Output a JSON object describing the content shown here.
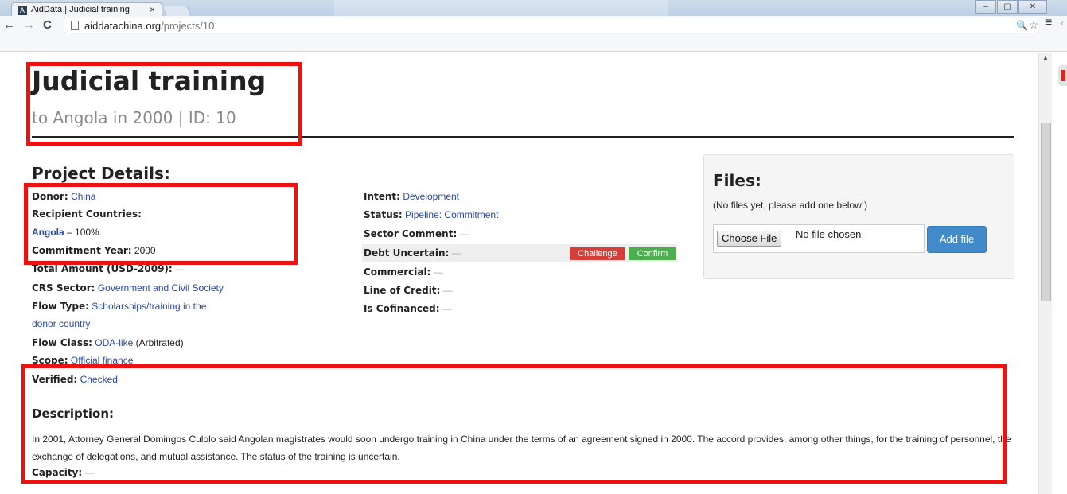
{
  "browser": {
    "tab_title": "AidData | Judicial training",
    "tab_close": "×",
    "favicon": "A",
    "url_host": "aiddatachina.org",
    "url_path": "/projects/10",
    "window_buttons": [
      "–",
      "▢",
      "✕"
    ]
  },
  "page": {
    "title": "Judicial training",
    "subtitle": "to Angola in 2000 | ID: 10",
    "details_heading": "Project Details:",
    "dash": "—",
    "left": {
      "donor_label": "Donor:",
      "donor_value": "China",
      "recipient_label": "Recipient Countries:",
      "recipient_country": "Angola",
      "recipient_share": "– 100%",
      "commitment_label": "Commitment Year:",
      "commitment_value": "2000",
      "total_label": "Total Amount (USD-2009):",
      "crs_label": "CRS Sector:",
      "crs_value": "Government and Civil Society",
      "flow_type_label": "Flow Type:",
      "flow_type_line1": "Scholarships/training in the",
      "flow_type_line2": "donor country",
      "flow_class_label": "Flow Class:",
      "flow_class_value": "ODA-like",
      "flow_class_note": "(Arbitrated)",
      "scope_label": "Scope:",
      "scope_value": "Official finance",
      "verified_label": "Verified:",
      "verified_value": "Checked"
    },
    "middle": {
      "intent_label": "Intent:",
      "intent_value": "Development",
      "status_label": "Status:",
      "status_value": "Pipeline: Commitment",
      "sector_comment_label": "Sector Comment:",
      "debt_label": "Debt Uncertain:",
      "challenge_label": "Challenge",
      "confirm_label": "Confirm",
      "commercial_label": "Commercial:",
      "loc_label": "Line of Credit:",
      "cofinanced_label": "Is Cofinanced:"
    },
    "files": {
      "heading": "Files:",
      "empty_text": "(No files yet, please add one below!)",
      "choose_label": "Choose File",
      "no_file_text": "No file chosen",
      "add_label": "Add file"
    },
    "description": {
      "heading": "Description:",
      "text": "In 2001, Attorney General Domingos Culolo said Angolan magistrates would soon undergo training in China under the terms of an agreement signed in 2000. The accord provides, among other things, for the training of personnel, the exchange of delegations, and mutual assistance. The status of the training is uncertain.",
      "capacity_label": "Capacity:"
    }
  },
  "colors": {
    "link": "#2a4aa0",
    "challenge": "#d43f3a",
    "confirm": "#4cae4c",
    "add_file": "#428bca",
    "annotation": "#ee1111"
  }
}
